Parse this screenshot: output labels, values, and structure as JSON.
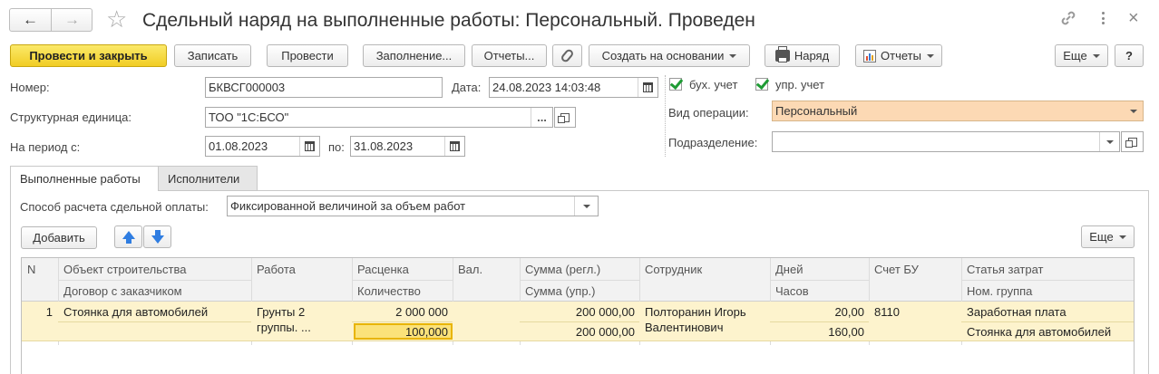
{
  "window": {
    "title": "Сдельный наряд на выполненные работы: Персональный. Проведен"
  },
  "toolbar": {
    "post_close": "Провести и закрыть",
    "save": "Записать",
    "post": "Провести",
    "fill": "Заполнение...",
    "reports": "Отчеты...",
    "create_based": "Создать на основании",
    "order": "Наряд",
    "reports2": "Отчеты",
    "more": "Еще",
    "help": "?"
  },
  "form": {
    "number_label": "Номер:",
    "number_value": "БКВСГ000003",
    "date_label": "Дата:",
    "date_value": "24.08.2023 14:03:48",
    "unit_label": "Структурная единица:",
    "unit_value": "ТОО \"1С:БСО\"",
    "period_label": "На период с:",
    "period_from": "01.08.2023",
    "period_to_label": "по:",
    "period_to": "31.08.2023",
    "acc_label": "бух. учет",
    "mgmt_label": "упр. учет",
    "op_label": "Вид операции:",
    "op_value": "Персональный",
    "dept_label": "Подразделение:",
    "dept_value": ""
  },
  "tabs": [
    {
      "label": "Выполненные работы"
    },
    {
      "label": "Исполнители"
    }
  ],
  "tab_content": {
    "method_label": "Способ расчета сдельной оплаты:",
    "method_value": "Фиксированной величиной за объем работ",
    "add": "Добавить",
    "more": "Еще"
  },
  "table": {
    "headers_top": [
      "N",
      "Объект строительства",
      "Работа",
      "Расценка",
      "Вал.",
      "Сумма (регл.)",
      "Сотрудник",
      "Дней",
      "Счет БУ",
      "Статья затрат"
    ],
    "headers_bottom": [
      "Договор с заказчиком",
      "Количество",
      "Сумма (упр.)",
      "Часов",
      "Ном. группа"
    ],
    "row": {
      "n": "1",
      "object": "Стоянка для автомобилей",
      "work_1": "Грунты 2",
      "work_2": "группы. ...",
      "rate": "2 000 000",
      "qty": "100,000",
      "sum_reg": "200 000,00",
      "sum_mgmt": "200 000,00",
      "employee_1": "Полторанин Игорь",
      "employee_2": "Валентинович",
      "days": "20,00",
      "hours": "160,00",
      "account": "8110",
      "cost_item": "Заработная плата",
      "nom_group": "Стоянка для автомобилей"
    }
  },
  "colors": {
    "primary_button": "#f1cd24",
    "operation_field": "#fcd9b4",
    "selected_row": "#fdf3cd",
    "check": "#1e9b34"
  }
}
